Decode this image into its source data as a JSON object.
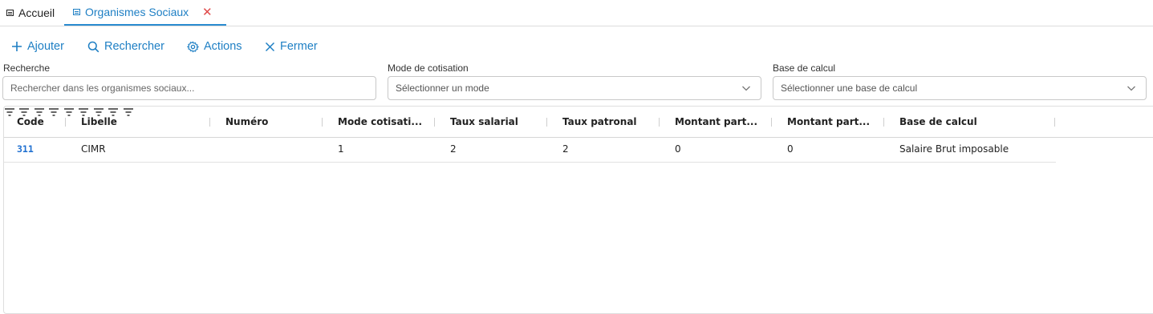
{
  "tabs": [
    {
      "label": "Accueil",
      "icon": "table-icon"
    },
    {
      "label": "Organismes Sociaux",
      "icon": "table-icon",
      "close_icon": "close-icon",
      "active": true
    }
  ],
  "toolbar": {
    "add_label": "Ajouter",
    "search_label": "Rechercher",
    "actions_label": "Actions",
    "close_label": "Fermer"
  },
  "filters": {
    "search_label": "Recherche",
    "search_placeholder": "Rechercher dans les organismes sociaux...",
    "mode_label": "Mode de cotisation",
    "mode_placeholder": "Sélectionner un mode",
    "base_label": "Base de calcul",
    "base_placeholder": "Sélectionner une base de calcul"
  },
  "table": {
    "columns": [
      "Code",
      "Libelle",
      "Numéro",
      "Mode cotisati...",
      "Taux salarial",
      "Taux patronal",
      "Montant part...",
      "Montant part...",
      "Base de calcul"
    ],
    "rows": [
      [
        "311",
        "CIMR",
        "",
        "1",
        "2",
        "2",
        "0",
        "0",
        "Salaire Brut imposable"
      ]
    ]
  },
  "colors": {
    "accent": "#1e7fc4",
    "link": "#1e6fd0",
    "close": "#e04a4a"
  }
}
